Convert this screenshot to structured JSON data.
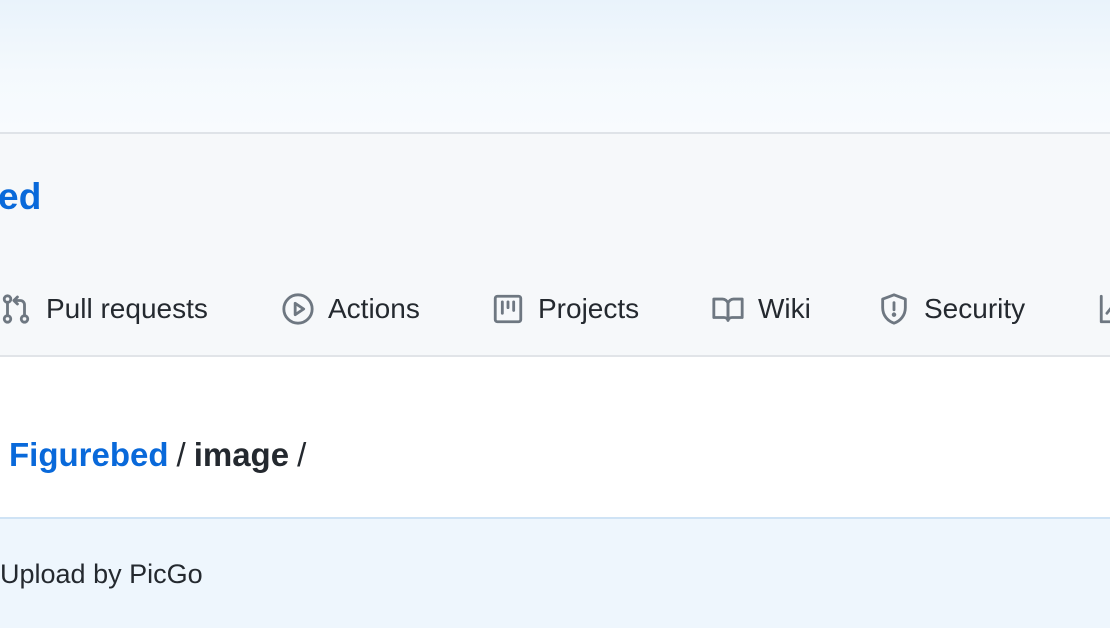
{
  "repo": {
    "name_visible": "ed"
  },
  "tabs": [
    {
      "label": "Pull requests",
      "icon": "pull-request-icon"
    },
    {
      "label": "Actions",
      "icon": "play-icon"
    },
    {
      "label": "Projects",
      "icon": "project-board-icon"
    },
    {
      "label": "Wiki",
      "icon": "book-icon"
    },
    {
      "label": "Security",
      "icon": "shield-icon"
    },
    {
      "label": "",
      "icon": "graph-icon"
    }
  ],
  "breadcrumb": {
    "repo_link": "Figurebed",
    "separator": "/",
    "folder": "image",
    "trailing_separator": "/"
  },
  "commit": {
    "message": "Upload by PicGo"
  },
  "colors": {
    "link": "#0969da",
    "text": "#24292f",
    "icon": "#6e7781",
    "header_bg": "#f6f8fa",
    "commit_bg": "#eef6fd"
  }
}
